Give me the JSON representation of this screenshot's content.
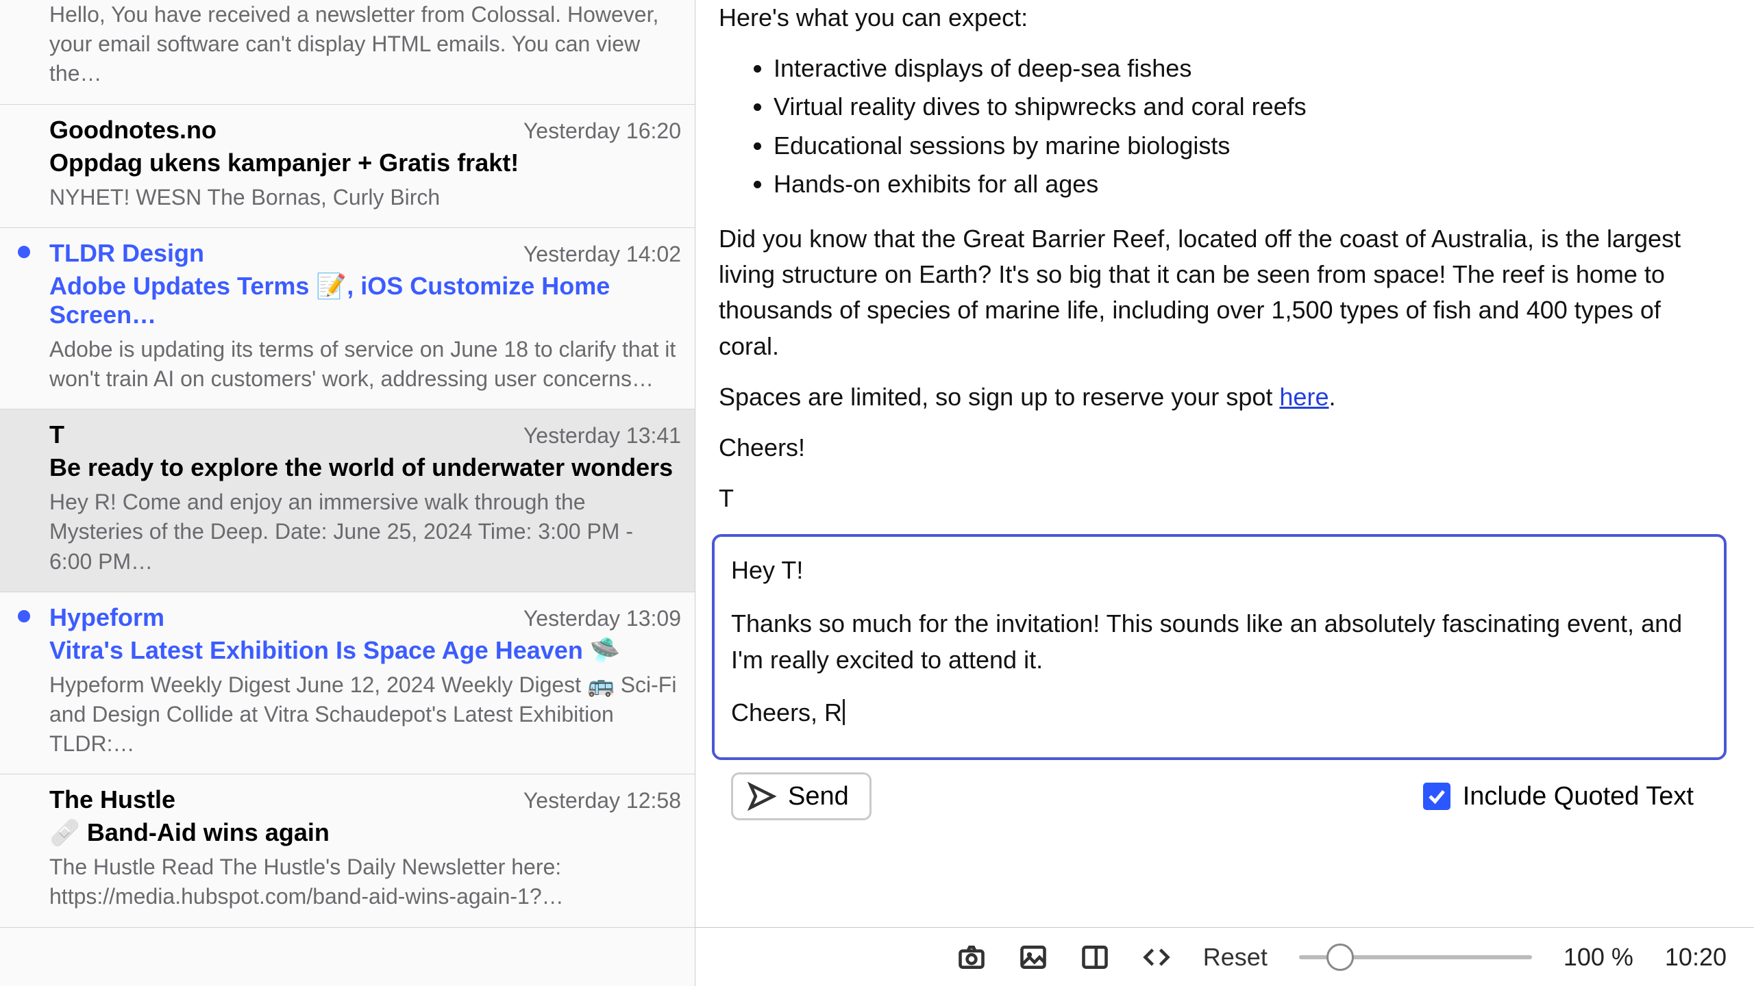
{
  "sidebar": {
    "items": [
      {
        "sender": "",
        "time": "",
        "subject": "",
        "preview": "Hello, You have received a newsletter from Colossal. However, your email software can't display HTML emails. You can view the…",
        "unread": false
      },
      {
        "sender": "Goodnotes.no",
        "time": "Yesterday 16:20",
        "subject": "Oppdag ukens kampanjer + Gratis frakt!",
        "preview": "NYHET! WESN The Bornas, Curly Birch",
        "unread": false
      },
      {
        "sender": "TLDR Design",
        "time": "Yesterday 14:02",
        "subject": "Adobe Updates Terms 📝, iOS Customize Home Screen…",
        "preview": "Adobe is updating its terms of service on June 18 to clarify that it won't train AI on customers' work, addressing user concerns…",
        "unread": true
      },
      {
        "sender": "T",
        "time": "Yesterday 13:41",
        "subject": "Be ready to explore the world of underwater wonders",
        "preview": "Hey R! Come and enjoy an immersive walk through the Mysteries of the Deep. Date: June 25, 2024 Time: 3:00 PM - 6:00 PM…",
        "unread": false,
        "selected": true
      },
      {
        "sender": "Hypeform",
        "time": "Yesterday 13:09",
        "subject": "Vitra's Latest Exhibition Is Space Age Heaven 🛸",
        "preview": "Hypeform Weekly Digest June 12, 2024 Weekly Digest 🚌 Sci-Fi and Design Collide at Vitra Schaudepot's Latest Exhibition TLDR:…",
        "unread": true
      },
      {
        "sender": "The Hustle",
        "time": "Yesterday 12:58",
        "subject": "🩹 Band-Aid wins again",
        "preview": "The Hustle Read The Hustle's Daily Newsletter here: https://media.hubspot.com/band-aid-wins-again-1?…",
        "unread": false
      }
    ]
  },
  "reading": {
    "intro": "Here's what you can expect:",
    "bullets": [
      "Interactive displays of deep-sea fishes",
      "Virtual reality dives to shipwrecks and coral reefs",
      "Educational sessions by marine biologists",
      "Hands-on exhibits for all ages"
    ],
    "fact": "Did you know that the Great Barrier Reef, located off the coast of Australia, is the largest living structure on Earth? It's so big that it can be seen from space! The reef is home to thousands of species of marine life, including over 1,500 types of fish and 400 types of coral.",
    "cta_pre": "Spaces are limited, so sign up to reserve your spot ",
    "cta_link": "here",
    "cta_post": ".",
    "cheers": "Cheers!",
    "signature": "T"
  },
  "compose": {
    "greeting": "Hey T!",
    "body": "Thanks so much for the invitation! This sounds like an absolutely fascinating event, and I'm really excited to attend it.",
    "closing": "Cheers, R"
  },
  "actions": {
    "send_label": "Send",
    "include_quoted_label": "Include Quoted Text",
    "include_quoted_checked": true
  },
  "toolbar": {
    "reset_label": "Reset",
    "zoom_percent": "100 %",
    "clock": "10:20"
  }
}
